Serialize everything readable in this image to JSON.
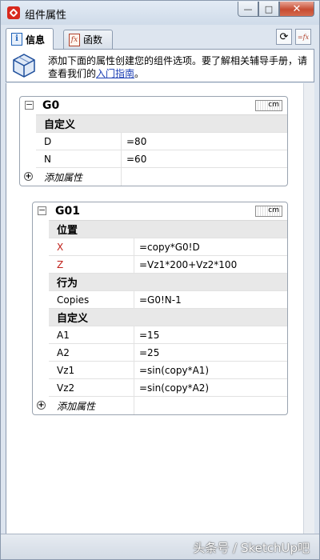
{
  "window": {
    "title": "组件属性",
    "minimize": "—",
    "maximize": "□",
    "close": "✕"
  },
  "tabs": [
    {
      "label": "信息",
      "icon": "info-icon",
      "active": true
    },
    {
      "label": "函数",
      "icon": "function-icon",
      "active": false
    }
  ],
  "toolbar": {
    "refresh_icon": "refresh-icon",
    "formula_icon": "toggle-formula-icon",
    "formula_label": "=fx"
  },
  "banner": {
    "text_before": "添加下面的属性创建您的组件选项。要了解相关辅导手册，请查看我们的",
    "link": "入门指南",
    "text_after": "。"
  },
  "components": [
    {
      "name": "G0",
      "unit": "cm",
      "collapse_glyph": "−",
      "rows": [
        {
          "type": "section",
          "label": "自定义"
        },
        {
          "type": "attr",
          "key": "D",
          "value": "=80",
          "highlight": false
        },
        {
          "type": "attr",
          "key": "N",
          "value": "=60",
          "highlight": false
        }
      ],
      "add_label": "添加属性"
    },
    {
      "name": "G01",
      "unit": "cm",
      "collapse_glyph": "−",
      "rows": [
        {
          "type": "section",
          "label": "位置"
        },
        {
          "type": "attr",
          "key": "X",
          "value": "=copy*G0!D",
          "highlight": true
        },
        {
          "type": "attr",
          "key": "Z",
          "value": "=Vz1*200+Vz2*100",
          "highlight": true
        },
        {
          "type": "section",
          "label": "行为"
        },
        {
          "type": "attr",
          "key": "Copies",
          "value": "=G0!N-1",
          "highlight": false
        },
        {
          "type": "section",
          "label": "自定义"
        },
        {
          "type": "attr",
          "key": "A1",
          "value": "=15",
          "highlight": false
        },
        {
          "type": "attr",
          "key": "A2",
          "value": "=25",
          "highlight": false
        },
        {
          "type": "attr",
          "key": "Vz1",
          "value": "=sin(copy*A1)",
          "highlight": false
        },
        {
          "type": "attr",
          "key": "Vz2",
          "value": "=sin(copy*A2)",
          "highlight": false
        }
      ],
      "add_label": "添加属性"
    }
  ],
  "status": {
    "watermark": "头条号 / SketchUp吧"
  }
}
